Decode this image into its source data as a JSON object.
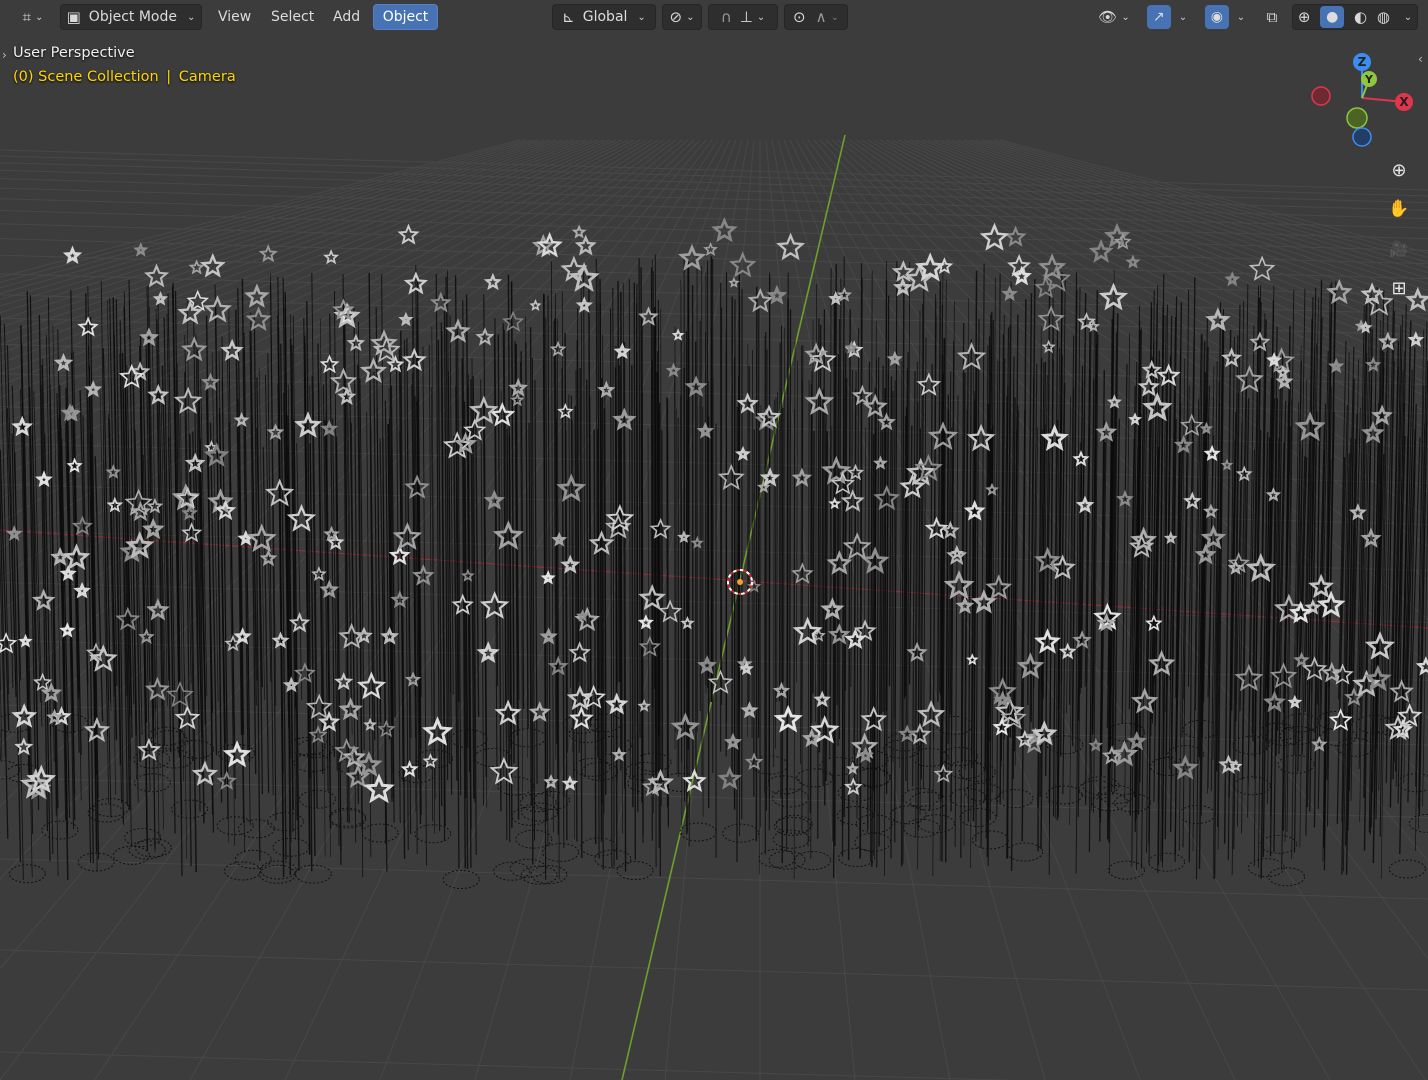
{
  "header": {
    "mode_label": "Object Mode",
    "menus": [
      "View",
      "Select",
      "Add",
      "Object"
    ],
    "active_menu": "Object",
    "transform_orientation": "Global"
  },
  "overlay": {
    "view_name": "User Perspective",
    "collection_prefix": "(0) Scene Collection",
    "separator": "|",
    "active_object": "Camera"
  },
  "gizmo": {
    "axes": [
      "Z",
      "Y",
      "X"
    ],
    "colors": {
      "x": "#e0364d",
      "y": "#8ec63f",
      "z": "#3b8ef0"
    }
  },
  "nav_buttons": [
    {
      "name": "zoom-icon",
      "glyph": "⊕"
    },
    {
      "name": "hand-pan-icon",
      "glyph": "✋"
    },
    {
      "name": "camera-view-icon",
      "glyph": "🎥"
    },
    {
      "name": "ortho-toggle-icon",
      "glyph": "⊞"
    }
  ],
  "colors": {
    "viewport_bg": "#3d3d3d",
    "grid_line": "#4a4a4a",
    "x_axis": "#b03242",
    "y_axis": "#6a9a2a",
    "accent": "#4772b3",
    "collection_text": "#ffd600"
  }
}
